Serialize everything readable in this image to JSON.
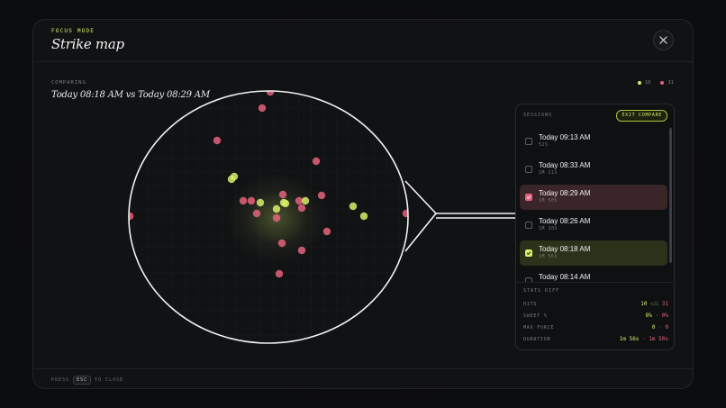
{
  "header": {
    "eyebrow": "FOCUS MODE",
    "title": "Strike map",
    "close_icon": "close-icon"
  },
  "comparison": {
    "label": "COMPARING",
    "title": "Today 08:18 AM vs Today 08:29 AM"
  },
  "legend": {
    "items": [
      {
        "value": "10",
        "color": "#d7ee6a"
      },
      {
        "value": "31",
        "color": "#e4637c"
      }
    ]
  },
  "sidebar": {
    "label": "SESSIONS",
    "exit_label": "EXIT COMPARE",
    "sessions": [
      {
        "time": "Today 09:13 AM",
        "duration": "52S",
        "state": "unchecked"
      },
      {
        "time": "Today 08:33 AM",
        "duration": "1M 21S",
        "state": "unchecked"
      },
      {
        "time": "Today 08:29 AM",
        "duration": "1M 50S",
        "state": "pink"
      },
      {
        "time": "Today 08:26 AM",
        "duration": "1M 10S",
        "state": "unchecked"
      },
      {
        "time": "Today 08:18 AM",
        "duration": "1M 56S",
        "state": "green"
      },
      {
        "time": "Today 08:14 AM",
        "duration": "",
        "state": "unchecked"
      }
    ]
  },
  "stats": {
    "label": "STATS DIFF",
    "rows": [
      {
        "name": "HITS",
        "a": "10",
        "delta": "+21",
        "b": "31"
      },
      {
        "name": "SWEET %",
        "a": "8%",
        "sep": "·",
        "b": "0%"
      },
      {
        "name": "MAX FORCE",
        "a": "0",
        "sep": "·",
        "b": "0"
      },
      {
        "name": "DURATION",
        "a": "1m 56s",
        "sep": "·",
        "b": "1m 50s"
      }
    ]
  },
  "footer": {
    "press": "PRESS",
    "key": "ESC",
    "suffix": "TO CLOSE"
  },
  "colors": {
    "green": "#d7ee6a",
    "pink": "#e4637c"
  }
}
